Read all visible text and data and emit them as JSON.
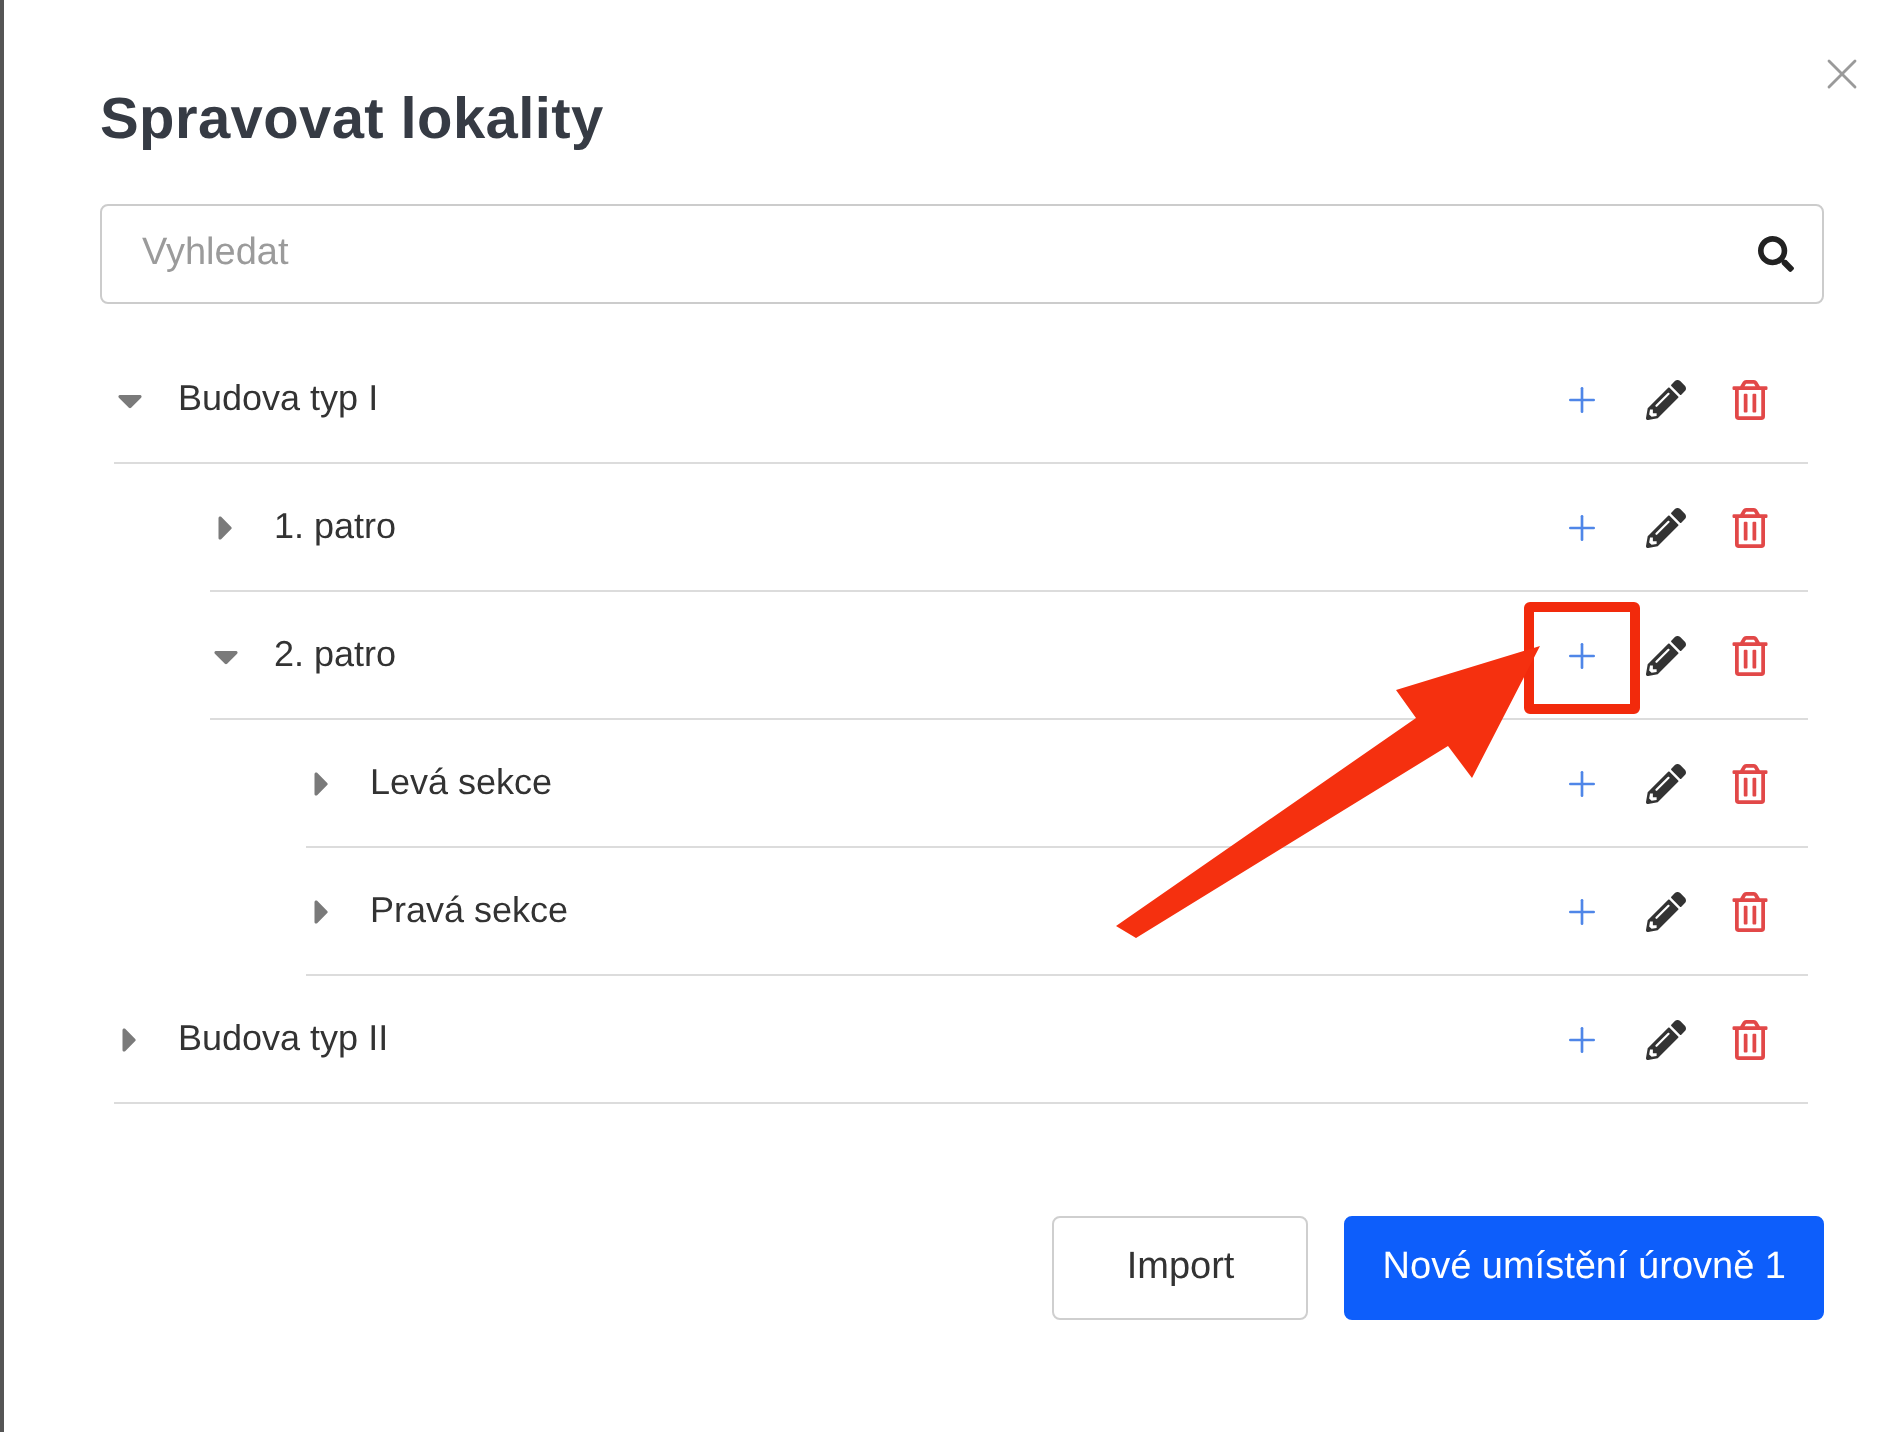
{
  "dialog": {
    "title": "Spravovat lokality"
  },
  "search": {
    "placeholder": "Vyhledat"
  },
  "tree": [
    {
      "label": "Budova typ I",
      "expanded": true,
      "highlighted": false,
      "children": [
        {
          "label": "1. patro",
          "expanded": false,
          "highlighted": false
        },
        {
          "label": "2. patro",
          "expanded": true,
          "highlighted": true,
          "children": [
            {
              "label": "Levá sekce",
              "expanded": false,
              "highlighted": false
            },
            {
              "label": "Pravá sekce",
              "expanded": false,
              "highlighted": false
            }
          ]
        }
      ]
    },
    {
      "label": "Budova typ II",
      "expanded": false,
      "highlighted": false
    }
  ],
  "buttons": [
    {
      "label": "Import",
      "kind": "secondary"
    },
    {
      "label": "Nové umístění úrovně 1",
      "kind": "primary"
    }
  ]
}
